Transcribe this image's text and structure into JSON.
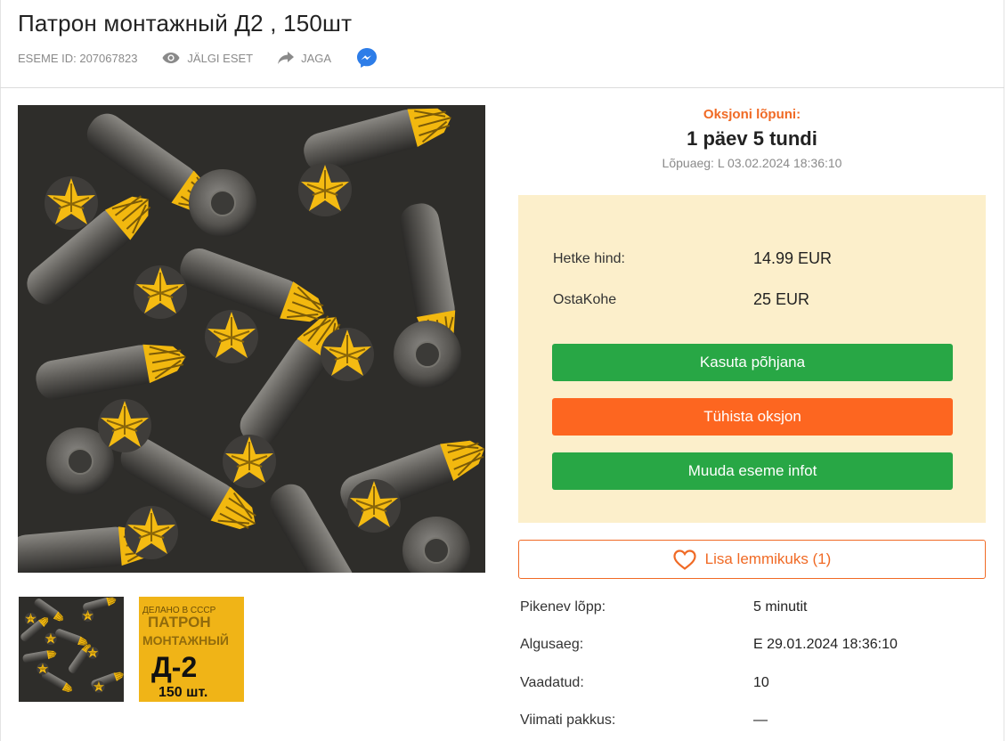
{
  "header": {
    "title": "Патрон монтажный Д2 , 150шт",
    "item_id": "ESEME ID: 207067823",
    "watch_label": "JÄLGI ESET",
    "share_label": "JAGA"
  },
  "gallery": {
    "main_image": "ammo-cartridges-photo",
    "thumbnails": [
      {
        "name": "cartridges-thumbnail"
      },
      {
        "name": "package-label-thumbnail",
        "text_line1": "ДЕЛАНО В СССР",
        "text_line2": "ПАТРОН",
        "text_line3": "МОНТАЖНЫЙ",
        "text_big": "Д-2",
        "text_count": "150 шт."
      }
    ]
  },
  "auction": {
    "end_label": "Oksjoni lõpuni:",
    "time_left": "1 päev 5 tundi",
    "end_time": "Lõpuaeg: L 03.02.2024 18:36:10"
  },
  "price": {
    "current_label": "Hetke hind:",
    "current_value": "14.99 EUR",
    "buy_now_label": "OstaKohe",
    "buy_now_value": "25 EUR"
  },
  "actions": {
    "use_template": "Kasuta põhjana",
    "cancel_auction": "Tühista oksjon",
    "edit_item": "Muuda eseme infot",
    "favorite": "Lisa lemmikuks (1)"
  },
  "details": [
    {
      "label": "Pikenev lõpp:",
      "value": "5 minutit"
    },
    {
      "label": "Algusaeg:",
      "value": "E 29.01.2024 18:36:10"
    },
    {
      "label": "Vaadatud:",
      "value": "10"
    },
    {
      "label": "Viimati pakkus:",
      "value": "—"
    }
  ],
  "colors": {
    "accent_orange": "#f06a25",
    "button_green": "#28a745",
    "button_orange": "#fd6620",
    "price_box_bg": "#fcefcb",
    "messenger_blue": "#2d7de8"
  }
}
